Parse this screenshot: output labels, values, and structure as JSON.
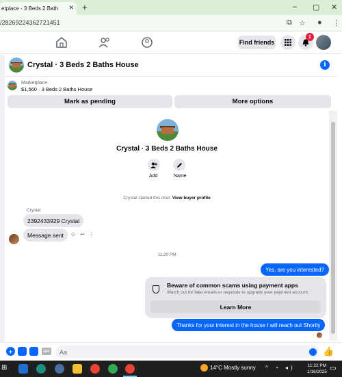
{
  "browser": {
    "tab_title": "etplace - 3 Beds 2 Bath",
    "tab_close": "✕",
    "new_tab": "+",
    "url": "/28269224362721451",
    "window_min": "–",
    "window_max": "▢",
    "window_close": "✕"
  },
  "fbnav": {
    "find_friends": "Find friends",
    "notification_count": "1"
  },
  "chat": {
    "title": "Crystal · 3 Beds 2 Baths House"
  },
  "listing": {
    "source": "Marketplace",
    "price_line": "$1,560 · 3 Beds 2 Baths House",
    "mark_pending": "Mark as pending",
    "more_options": "More options"
  },
  "conversation": {
    "title": "Crystal · 3 Beds 2 Baths House",
    "add_label": "Add",
    "name_label": "Name",
    "started_text": "Crystal started this chat. ",
    "view_profile": "View buyer profile",
    "sender_name": "Crystal",
    "messages_in": [
      "2392433929 Crystal",
      "Message sent"
    ],
    "timestamp": "11:20 PM",
    "reply_1": "Yes, are you interested?",
    "warning_title": "Beware of common scams using payment apps",
    "warning_sub": "Watch out for fake emails or requests to upgrade your payment account.",
    "learn_more": "Learn More",
    "reply_2": "Thanks for your interest in the house I will reach out Shortly"
  },
  "composer": {
    "placeholder": "Aa",
    "gif": "GIF"
  },
  "taskbar": {
    "weather": "14°C  Mostly sunny",
    "time": "11:22 PM",
    "date": "1/16/2025"
  },
  "colors": {
    "accent": "#0866ff",
    "tabstrip": "#dcefd6"
  }
}
